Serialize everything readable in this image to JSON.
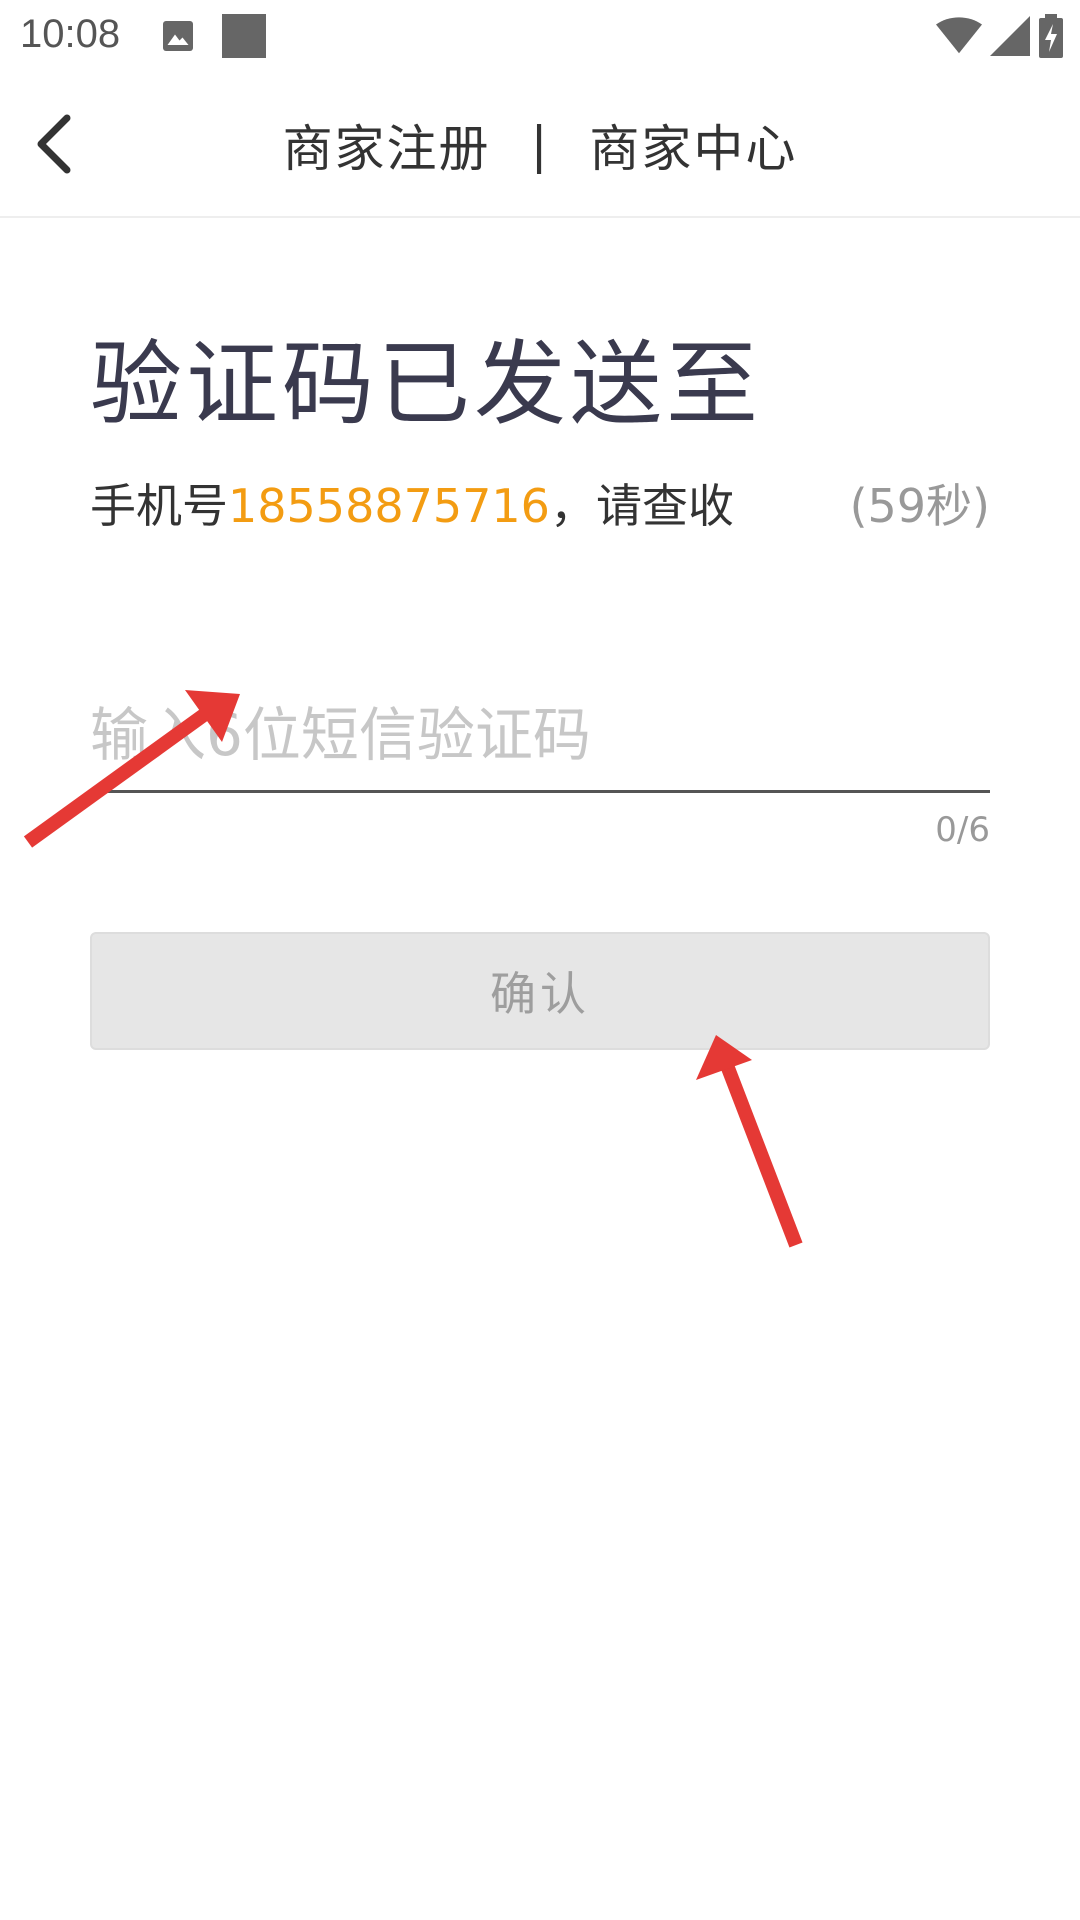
{
  "status_bar": {
    "time": "10:08",
    "icons": [
      "image-icon",
      "square-notification-icon",
      "wifi-icon",
      "signal-icon",
      "battery-charging-icon"
    ]
  },
  "header": {
    "title_left": "商家注册",
    "separator": "|",
    "title_right": "商家中心",
    "back_icon": "chevron-left-icon"
  },
  "main": {
    "heading": "验证码已发送至",
    "sub_prefix": "手机号",
    "phone": "18558875716",
    "sub_suffix": "，请查收",
    "countdown": "(59秒)",
    "code_input": {
      "placeholder": "输入6位短信验证码",
      "value": ""
    },
    "counter": "0/6",
    "confirm_label": "确认"
  },
  "colors": {
    "accent_phone": "#f39c12",
    "heading": "#3a3a4e",
    "button_bg": "#e6e6e6",
    "annotation_arrow": "#e53935"
  }
}
